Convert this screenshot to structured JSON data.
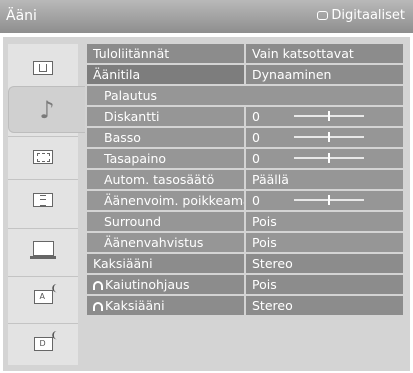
{
  "header": {
    "title": "Ääni",
    "digital_label": "Digitaaliset"
  },
  "sidebar": {
    "tabs": [
      {
        "icon": "picture-icon"
      },
      {
        "icon": "sound-note-icon",
        "active": true
      },
      {
        "icon": "screen-icon"
      },
      {
        "icon": "settings-list-icon"
      },
      {
        "icon": "pc-icon"
      },
      {
        "icon": "analog-tv-icon",
        "letter": "A"
      },
      {
        "icon": "digital-tv-icon",
        "letter": "D"
      }
    ]
  },
  "menu": {
    "rows": [
      {
        "label": "Tuloliitännät",
        "value": "Vain katsottavat",
        "level": 0
      },
      {
        "label": "Äänitila",
        "value": "Dynaaminen",
        "level": 0,
        "highlight": true
      },
      {
        "label": "Palautus",
        "value": null,
        "level": 1
      },
      {
        "label": "Diskantti",
        "value": "0",
        "level": 1,
        "slider": 0.5
      },
      {
        "label": "Basso",
        "value": "0",
        "level": 1,
        "slider": 0.5
      },
      {
        "label": "Tasapaino",
        "value": "0",
        "level": 1,
        "slider": 0.5
      },
      {
        "label": "Autom. tasosäätö",
        "value": "Päällä",
        "level": 1
      },
      {
        "label": "Äänenvoim. poikkeama",
        "value": "0",
        "level": 1,
        "slider": 0.5
      },
      {
        "label": "Surround",
        "value": "Pois",
        "level": 1
      },
      {
        "label": "Äänenvahvistus",
        "value": "Pois",
        "level": 1
      },
      {
        "label": "Kaksiääni",
        "value": "Stereo",
        "level": 0
      },
      {
        "label": "Kaiutinohjaus",
        "value": "Pois",
        "level": 0,
        "icon": "headphones-icon"
      },
      {
        "label": "Kaksiääni",
        "value": "Stereo",
        "level": 0,
        "icon": "headphones-icon"
      }
    ]
  }
}
